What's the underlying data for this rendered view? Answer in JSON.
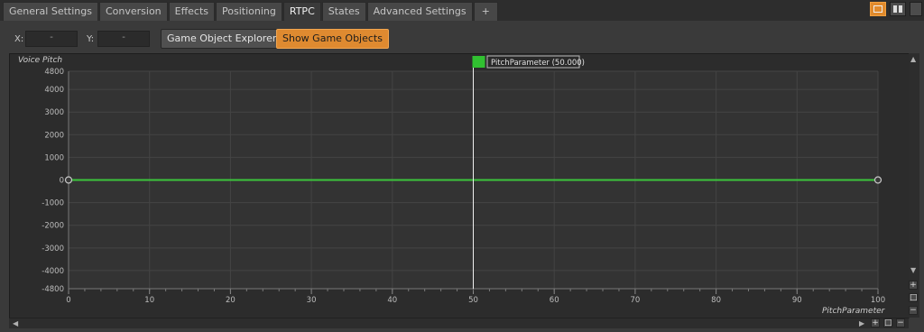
{
  "tabs": [
    {
      "label": "General Settings",
      "active": false
    },
    {
      "label": "Conversion",
      "active": false
    },
    {
      "label": "Effects",
      "active": false
    },
    {
      "label": "Positioning",
      "active": false
    },
    {
      "label": "RTPC",
      "active": true
    },
    {
      "label": "States",
      "active": false
    },
    {
      "label": "Advanced Settings",
      "active": false
    }
  ],
  "add_tab_label": "+",
  "toolbar": {
    "x_label": "X:",
    "x_value": "-",
    "y_label": "Y:",
    "y_value": "-",
    "explorer_button": "Game Object Explorer...",
    "show_button": "Show Game Objects"
  },
  "graph": {
    "y_axis_title": "Voice Pitch",
    "x_axis_title": "PitchParameter",
    "cursor_label": "PitchParameter (50.000)",
    "cursor_value": 50,
    "x_range": [
      0,
      100
    ],
    "y_range": [
      -4800,
      4800
    ],
    "x_ticks": [
      "0",
      "10",
      "20",
      "30",
      "40",
      "50",
      "60",
      "70",
      "80",
      "90",
      "100"
    ],
    "y_ticks": [
      "4800",
      "4000",
      "3000",
      "2000",
      "1000",
      "0",
      "-1000",
      "-2000",
      "-3000",
      "-4000",
      "-4800"
    ],
    "curve_points": [
      [
        0,
        0
      ],
      [
        100,
        0
      ]
    ],
    "curve_color": "#3cc43c",
    "cursor_swatch_color": "#31c131"
  },
  "accent_color": "#df8a30"
}
